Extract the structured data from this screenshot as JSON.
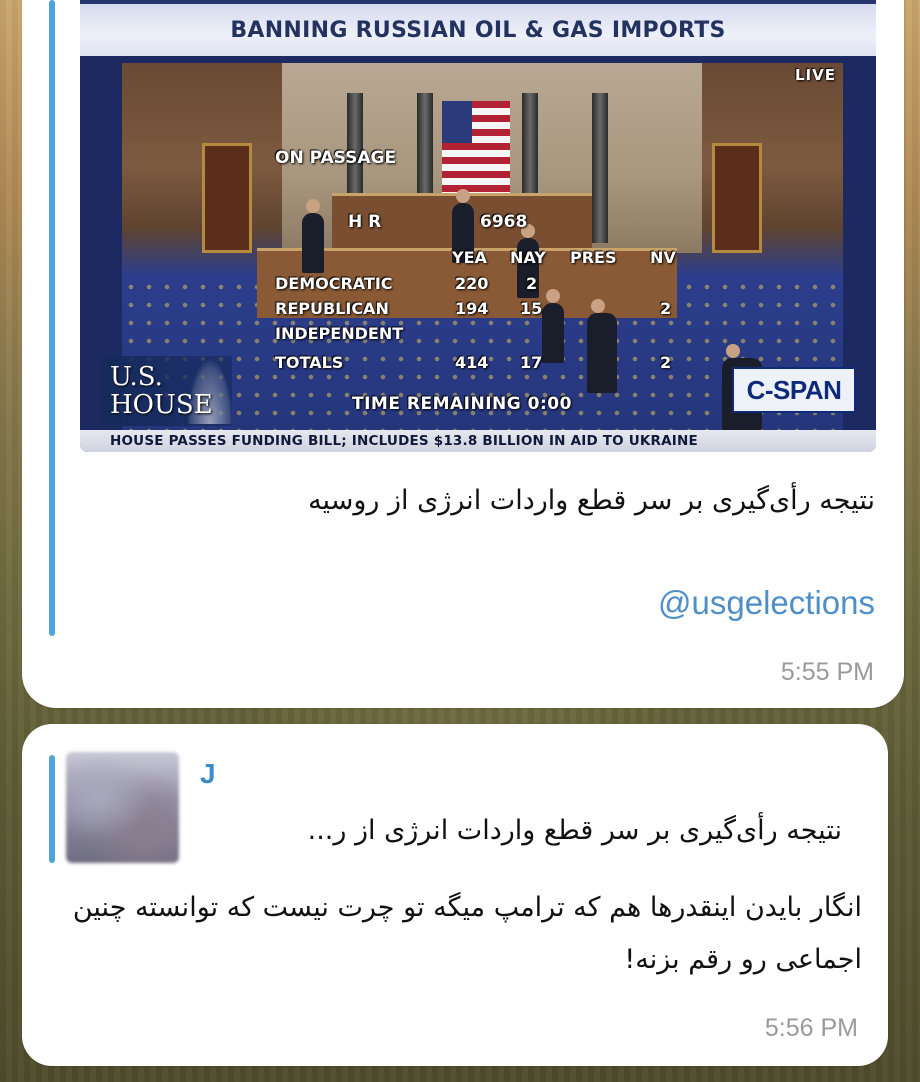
{
  "message_1": {
    "image": {
      "header": "BANNING RUSSIAN OIL & GAS IMPORTS",
      "live": "LIVE",
      "on_passage": "ON PASSAGE",
      "bill_prefix": "H R",
      "bill_number": "6968",
      "columns": [
        "YEA",
        "NAY",
        "PRES",
        "NV"
      ],
      "rows": [
        {
          "label": "DEMOCRATIC",
          "yea": "220",
          "nay": "2",
          "pres": "",
          "nv": ""
        },
        {
          "label": "REPUBLICAN",
          "yea": "194",
          "nay": "15",
          "pres": "",
          "nv": "2"
        },
        {
          "label": "INDEPENDENT",
          "yea": "",
          "nay": "",
          "pres": "",
          "nv": ""
        },
        {
          "label": "TOTALS",
          "yea": "414",
          "nay": "17",
          "pres": "",
          "nv": "2"
        }
      ],
      "house_logo_line1": "U.S.",
      "house_logo_line2": "HOUSE",
      "time_remaining": "TIME REMAINING   0:00",
      "network_logo": "C-SPAN",
      "ticker": "HOUSE PASSES FUNDING BILL; INCLUDES $13.8 BILLION IN AID TO UKRAINE"
    },
    "caption": "نتیجه رأی‌گیری بر سر قطع واردات انرژی از روسیه",
    "link": "@usgelections",
    "time": "5:55 PM"
  },
  "message_2": {
    "reply": {
      "name": "J",
      "snippet": "نتیجه رأی‌گیری بر سر قطع واردات انرژی از ر..."
    },
    "text": "انگار بایدن اینقدرها هم که ترامپ میگه تو چرت نیست که توانسته چنین اجماعی رو رقم بزنه!",
    "time": "5:56 PM"
  },
  "colors": {
    "quote_bar": "#4ea4d9",
    "link": "#4f8fc7",
    "reply_name": "#3b8bd0",
    "timestamp": "#9a9a9a"
  }
}
